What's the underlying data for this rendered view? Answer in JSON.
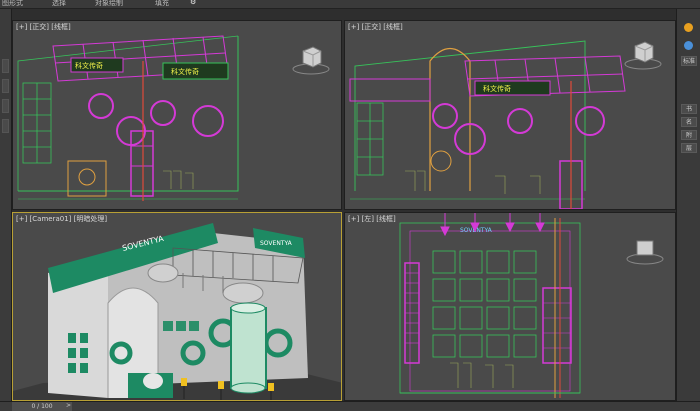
{
  "menu": {
    "items": [
      "图形式",
      "选择",
      "对象绘制",
      "填充"
    ]
  },
  "viewports": {
    "top_left": {
      "label": "[+] [正交] [线框]"
    },
    "top_right": {
      "label": "[+] [正交] [线框]"
    },
    "bottom_left": {
      "label": "[+] [Camera01] [明暗处理]"
    },
    "bottom_right": {
      "label": "[+] [左] [线框]"
    }
  },
  "scene_text": {
    "sign_a": "科文传奇",
    "sign_b": "科文传奇",
    "banner": "SOVENTYA",
    "vertical": "SOVENTYA",
    "brand_small": "SOVENTYA"
  },
  "command_panel": {
    "tab_labels": [
      "标准",
      "书",
      "名",
      "附",
      "层"
    ]
  },
  "timeline": {
    "frame_readout": "0 / 100",
    "prev": "<",
    "next": ">"
  },
  "colors": {
    "wire_green": "#37c25a",
    "wire_magenta": "#d43ad6",
    "wire_orange": "#e0a040",
    "shaded_green": "#1d8a63",
    "bg_viewport": "#4a4a4a",
    "active_border": "#b8a035"
  }
}
